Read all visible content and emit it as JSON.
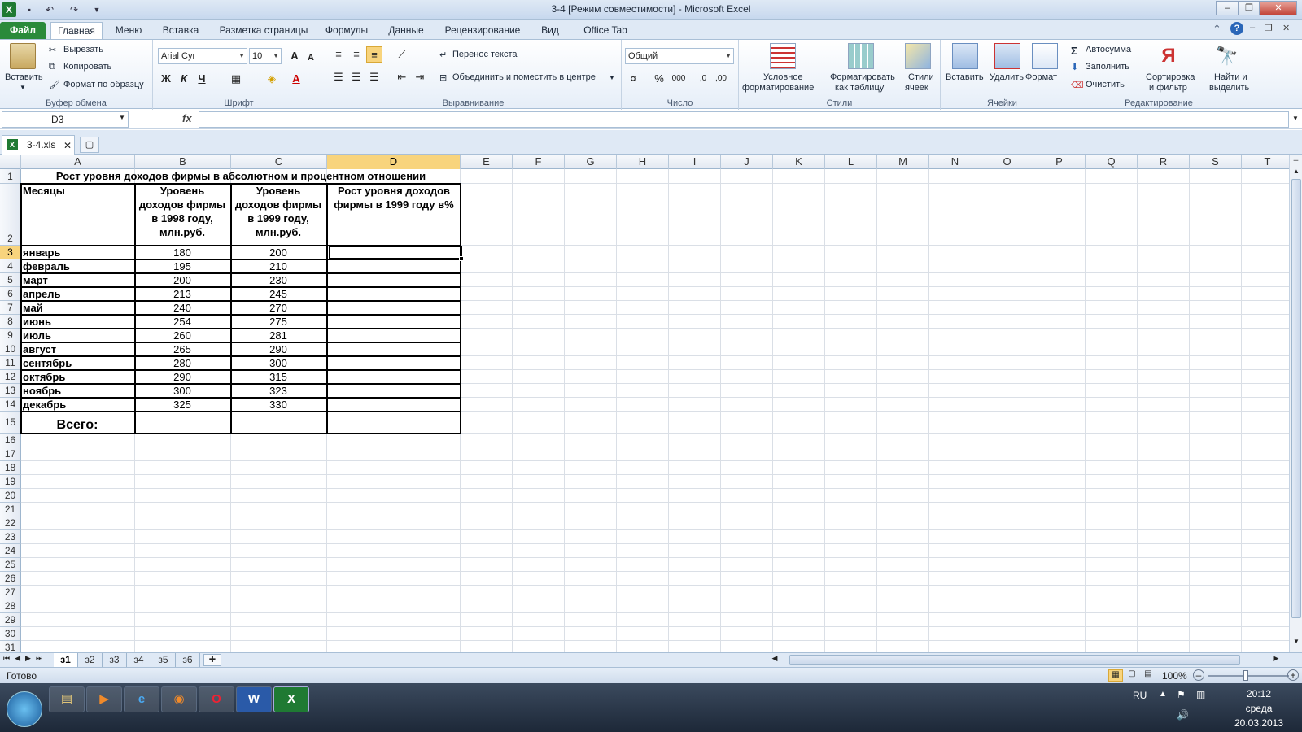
{
  "window": {
    "title": "3-4  [Режим совместимости]  -  Microsoft Excel",
    "undo_icon": "undo-icon",
    "redo_icon": "redo-icon"
  },
  "ribbon_tabs": [
    {
      "label": "Файл"
    },
    {
      "label": "Главная"
    },
    {
      "label": "Меню"
    },
    {
      "label": "Вставка"
    },
    {
      "label": "Разметка страницы"
    },
    {
      "label": "Формулы"
    },
    {
      "label": "Данные"
    },
    {
      "label": "Рецензирование"
    },
    {
      "label": "Вид"
    },
    {
      "label": "Office Tab"
    }
  ],
  "ribbon": {
    "clipboard": {
      "paste": "Вставить",
      "cut": "Вырезать",
      "copy": "Копировать",
      "format_painter": "Формат по образцу",
      "group": "Буфер обмена"
    },
    "font": {
      "name": "Arial Cyr",
      "size": "10",
      "bold": "Ж",
      "italic": "К",
      "underline": "Ч",
      "group": "Шрифт"
    },
    "alignment": {
      "wrap": "Перенос текста",
      "merge": "Объединить и поместить в центре",
      "group": "Выравнивание"
    },
    "number": {
      "format": "Общий",
      "percent": "%",
      "thousands": "000",
      "group": "Число"
    },
    "styles": {
      "conditional_1": "Условное",
      "conditional_2": "форматирование",
      "astable_1": "Форматировать",
      "astable_2": "как таблицу",
      "cellstyles_1": "Стили",
      "cellstyles_2": "ячеек",
      "group": "Стили"
    },
    "cells": {
      "insert": "Вставить",
      "delete": "Удалить",
      "format": "Формат",
      "group": "Ячейки"
    },
    "editing": {
      "autosum": "Автосумма",
      "fill": "Заполнить",
      "clear": "Очистить",
      "sort_1": "Сортировка",
      "sort_2": "и фильтр",
      "find_1": "Найти и",
      "find_2": "выделить",
      "group": "Редактирование"
    }
  },
  "formula_bar": {
    "name_box": "D3",
    "fx": "fx",
    "value": ""
  },
  "doc_tab": {
    "label": "3-4.xls"
  },
  "columns": [
    "A",
    "B",
    "C",
    "D",
    "E",
    "F",
    "G",
    "H",
    "I",
    "J",
    "K",
    "L",
    "M",
    "N",
    "O",
    "P",
    "Q",
    "R",
    "S",
    "T"
  ],
  "row_numbers": [
    "1",
    "2",
    "3",
    "4",
    "5",
    "6",
    "7",
    "8",
    "9",
    "10",
    "11",
    "12",
    "13",
    "14",
    "15",
    "16",
    "17",
    "18",
    "19",
    "20",
    "21",
    "22",
    "23",
    "24",
    "25",
    "26",
    "27",
    "28",
    "29",
    "30",
    "31"
  ],
  "sheet": {
    "title": "Рост уровня доходов фирмы в абсолютном и процентном отношении",
    "headers": {
      "a": "Месяцы",
      "b": [
        "Уровень",
        "доходов фирмы",
        "в 1998 году,",
        "млн.руб."
      ],
      "c": [
        "Уровень",
        "доходов фирмы",
        "в 1999 году,",
        "млн.руб."
      ],
      "d": [
        "Рост уровня доходов",
        "фирмы в 1999 году в%"
      ]
    },
    "rows": [
      {
        "month": "январь",
        "y1998": "180",
        "y1999": "200"
      },
      {
        "month": "февраль",
        "y1998": "195",
        "y1999": "210"
      },
      {
        "month": "март",
        "y1998": "200",
        "y1999": "230"
      },
      {
        "month": "апрель",
        "y1998": "213",
        "y1999": "245"
      },
      {
        "month": "май",
        "y1998": "240",
        "y1999": "270"
      },
      {
        "month": "июнь",
        "y1998": "254",
        "y1999": "275"
      },
      {
        "month": "июль",
        "y1998": "260",
        "y1999": "281"
      },
      {
        "month": "август",
        "y1998": "265",
        "y1999": "290"
      },
      {
        "month": "сентябрь",
        "y1998": "280",
        "y1999": "300"
      },
      {
        "month": "октябрь",
        "y1998": "290",
        "y1999": "315"
      },
      {
        "month": "ноябрь",
        "y1998": "300",
        "y1999": "323"
      },
      {
        "month": "декабрь",
        "y1998": "325",
        "y1999": "330"
      }
    ],
    "total": "Всего:"
  },
  "sheet_tabs": [
    "з1",
    "з2",
    "з3",
    "з4",
    "з5",
    "з6"
  ],
  "status": {
    "ready": "Готово",
    "zoom": "100%"
  },
  "taskbar": {
    "lang": "RU",
    "time": "20:12",
    "day": "среда",
    "date": "20.03.2013",
    "apps": [
      "explorer-icon",
      "media-player-icon",
      "ie-icon",
      "firefox-icon",
      "opera-icon",
      "word-icon",
      "excel-icon"
    ]
  }
}
